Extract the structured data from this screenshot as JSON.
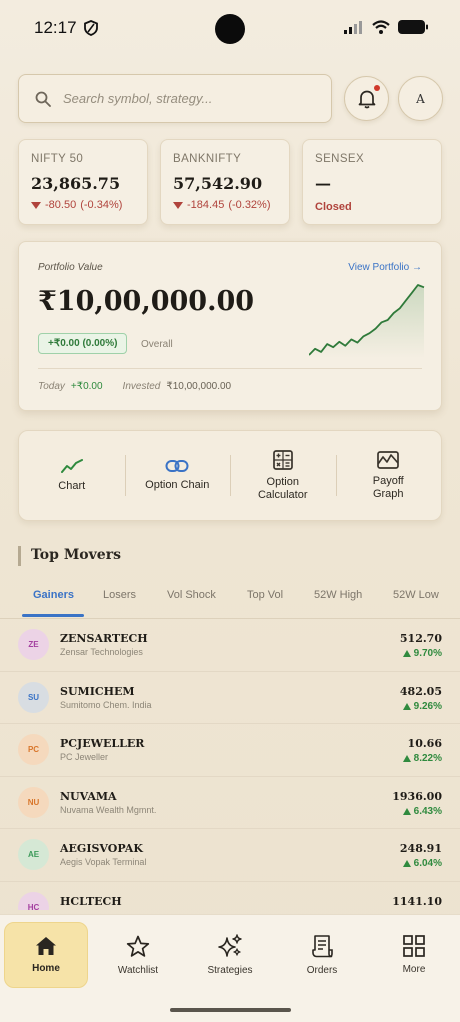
{
  "status_bar": {
    "time": "12:17"
  },
  "search": {
    "placeholder": "Search symbol, strategy..."
  },
  "profile": {
    "initial": "A"
  },
  "indices": [
    {
      "name": "NIFTY 50",
      "value": "23,865.75",
      "change": "-80.50",
      "pct": "(-0.34%)"
    },
    {
      "name": "BANKNIFTY",
      "value": "57,542.90",
      "change": "-184.45",
      "pct": "(-0.32%)"
    },
    {
      "name": "SENSEX",
      "value": "—",
      "status": "Closed"
    }
  ],
  "portfolio": {
    "label": "Portfolio Value",
    "link": "View Portfolio →",
    "value": "₹10,00,000.00",
    "change": "+₹0.00 (0.00%)",
    "overall_label": "Overall",
    "today_label": "Today",
    "today_value": "+₹0.00",
    "invested_label": "Invested",
    "invested_value": "₹10,00,000.00",
    "sparkline": [
      10,
      18,
      14,
      24,
      20,
      27,
      22,
      30,
      26,
      34,
      38,
      44,
      52,
      55,
      64,
      70,
      80,
      90,
      100,
      97
    ]
  },
  "tools": [
    {
      "label": "Chart",
      "icon": "chart-line-icon"
    },
    {
      "label": "Option Chain",
      "icon": "link-icon"
    },
    {
      "label": "Option\nCalculator",
      "icon": "calculator-icon"
    },
    {
      "label": "Payoff\nGraph",
      "icon": "payoff-graph-icon"
    }
  ],
  "top_movers": {
    "title": "Top Movers",
    "tabs": [
      "Gainers",
      "Losers",
      "Vol Shock",
      "Top Vol",
      "52W High",
      "52W Low"
    ],
    "active_tab": "Gainers",
    "rows": [
      {
        "initials": "ZE",
        "symbol": "ZENSARTECH",
        "name": "Zensar Technologies",
        "price": "512.70",
        "pct": "9.70%",
        "color": "#a43fa0",
        "bg": "#ecd3e6"
      },
      {
        "initials": "SU",
        "symbol": "SUMICHEM",
        "name": "Sumitomo Chem. India",
        "price": "482.05",
        "pct": "9.26%",
        "color": "#3a73c6",
        "bg": "#d8dde2"
      },
      {
        "initials": "PC",
        "symbol": "PCJEWELLER",
        "name": "PC Jeweller",
        "price": "10.66",
        "pct": "8.22%",
        "color": "#d9762b",
        "bg": "#f5d9bd"
      },
      {
        "initials": "NU",
        "symbol": "NUVAMA",
        "name": "Nuvama Wealth Mgmnt.",
        "price": "1936.00",
        "pct": "6.43%",
        "color": "#d9762b",
        "bg": "#f5d9bd"
      },
      {
        "initials": "AE",
        "symbol": "AEGISVOPAK",
        "name": "Aegis Vopak Terminal",
        "price": "248.91",
        "pct": "6.04%",
        "color": "#3c9a5a",
        "bg": "#d5e8d5"
      },
      {
        "initials": "HC",
        "symbol": "HCLTECH",
        "name": "",
        "price": "1141.10",
        "pct": "",
        "color": "#a43fa0",
        "bg": "#ecd3e6"
      }
    ]
  },
  "nav": [
    {
      "label": "Home",
      "icon": "home-icon",
      "active": true
    },
    {
      "label": "Watchlist",
      "icon": "star-icon"
    },
    {
      "label": "Strategies",
      "icon": "sparkles-icon"
    },
    {
      "label": "Orders",
      "icon": "receipt-icon"
    },
    {
      "label": "More",
      "icon": "grid-icon"
    }
  ],
  "colors": {
    "accent": "#3a73c6",
    "positive": "#2f8a3e",
    "negative": "#b0433c",
    "active_nav": "#f6e3a8"
  }
}
